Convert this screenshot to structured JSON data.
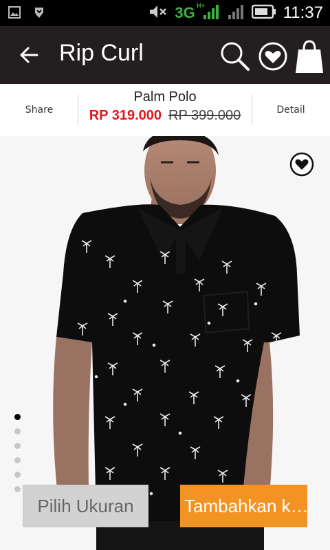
{
  "statusbar": {
    "network": "3G",
    "network_sup": "H+",
    "time": "11:37",
    "icons": [
      "image-icon",
      "shield-icon",
      "mute-icon",
      "signal-icon",
      "signal-weak-icon",
      "battery-icon"
    ]
  },
  "appbar": {
    "title": "Rip Curl",
    "actions": [
      "search-icon",
      "wishlist-icon",
      "shopping-bag-icon"
    ]
  },
  "product": {
    "share_label": "Share",
    "name": "Palm Polo",
    "sale_price": "RP 319.000",
    "original_price": "RP 399.000",
    "detail_label": "Detail"
  },
  "gallery": {
    "image_count": 6,
    "active_index": 0
  },
  "actions": {
    "size_label": "Pilih Ukuran",
    "add_label": "Tambahkan k…"
  },
  "colors": {
    "appbar_bg": "#231f20",
    "sale_price": "#e3151a",
    "add_button": "#f39324",
    "size_button": "#d2d2d2"
  }
}
